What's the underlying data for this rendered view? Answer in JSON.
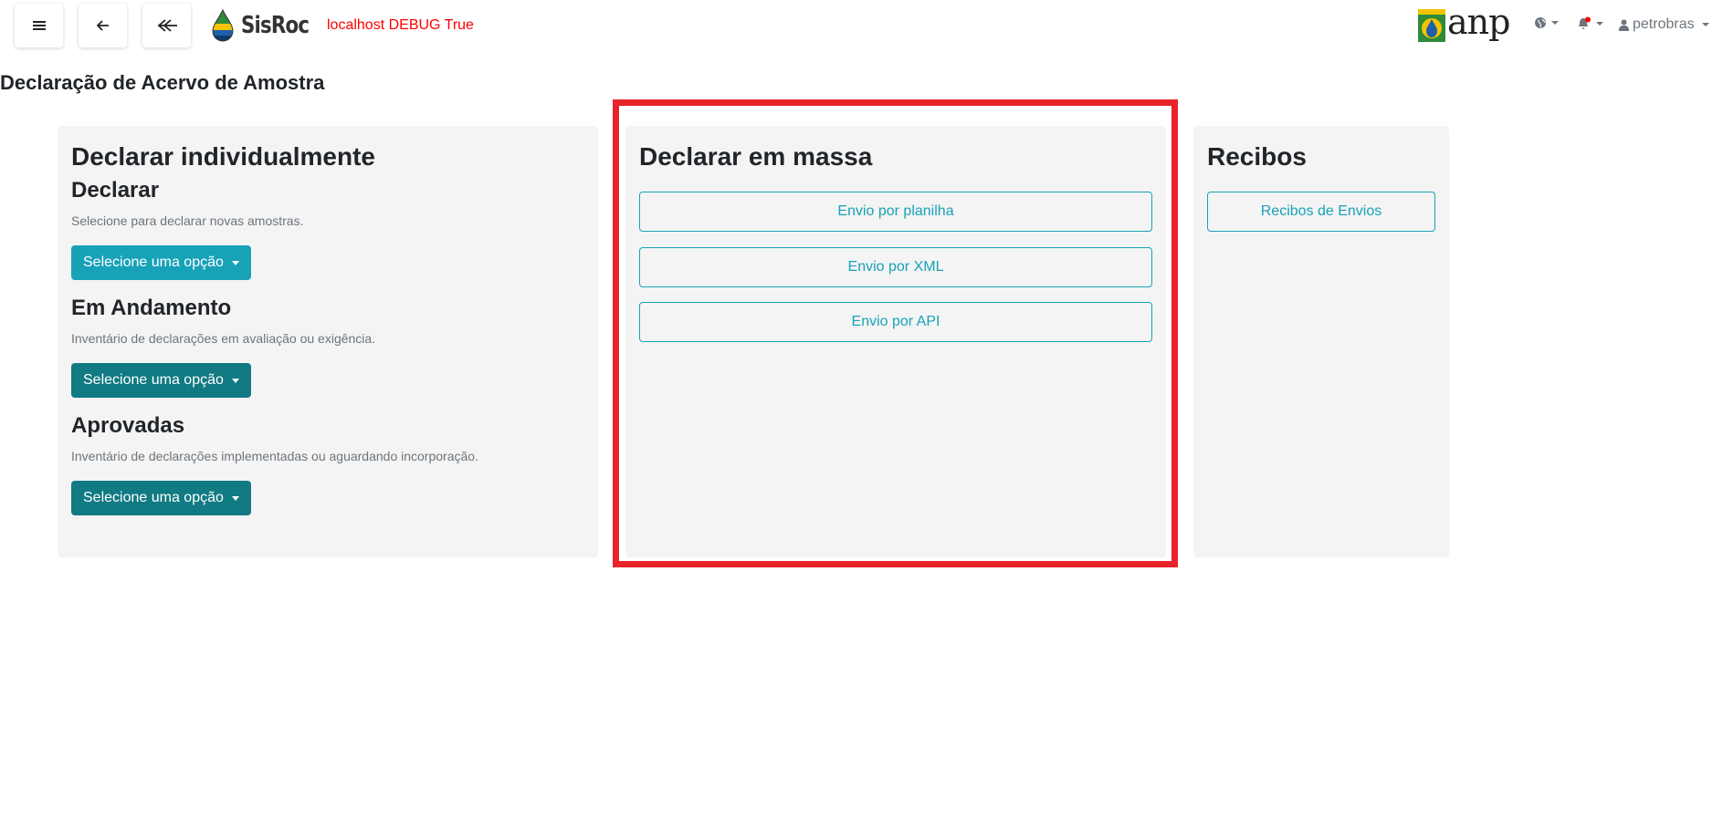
{
  "header": {
    "brand_name": "SisRoc",
    "debug_text": "localhost DEBUG True",
    "logo_text": "anp",
    "user_name": "petrobras",
    "icons": [
      "menu-icon",
      "arrow-left-icon",
      "double-chevron-left-icon",
      "globe-icon",
      "bell-icon",
      "user-icon"
    ]
  },
  "page": {
    "title": "Declaração de Acervo de Amostra"
  },
  "individual": {
    "title": "Declarar individualmente",
    "sections": [
      {
        "title": "Declarar",
        "description": "Selecione para declarar novas amostras.",
        "button": "Selecione uma opção"
      },
      {
        "title": "Em Andamento",
        "description": "Inventário de declarações em avaliação ou exigência.",
        "button": "Selecione uma opção"
      },
      {
        "title": "Aprovadas",
        "description": "Inventário de declarações implementadas ou aguardando incorporação.",
        "button": "Selecione uma opção"
      }
    ]
  },
  "mass": {
    "title": "Declarar em massa",
    "buttons": [
      "Envio por planilha",
      "Envio por XML",
      "Envio por API"
    ]
  },
  "receipts": {
    "title": "Recibos",
    "button": "Recibos de Envios"
  },
  "colors": {
    "info": "#17a2b8",
    "dark_teal": "#117a82",
    "highlight": "#e8242b",
    "debug": "#ff0000",
    "panel_bg": "#f4f4f4"
  }
}
